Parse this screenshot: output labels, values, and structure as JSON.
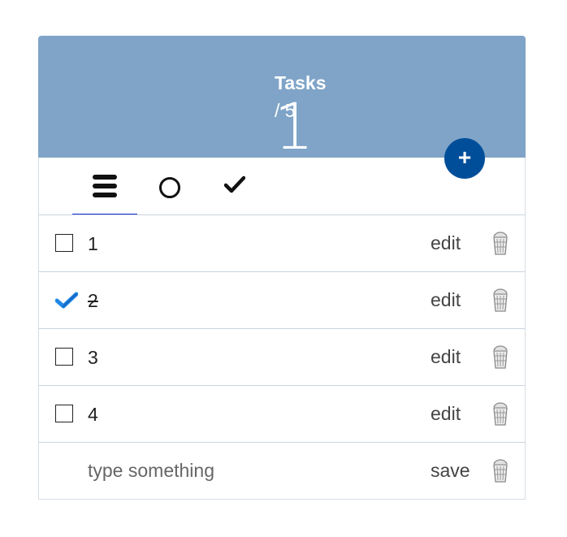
{
  "header": {
    "count": "1",
    "title": "Tasks",
    "total": "/ 5",
    "add_label": "+"
  },
  "tabs": [
    {
      "name": "all",
      "icon": "hamburger-icon",
      "active": true
    },
    {
      "name": "open",
      "icon": "circle-icon",
      "active": false
    },
    {
      "name": "done",
      "icon": "checkmark-icon",
      "active": false
    }
  ],
  "tasks": [
    {
      "text": "1",
      "done": false,
      "action": "edit"
    },
    {
      "text": "2",
      "done": true,
      "action": "edit"
    },
    {
      "text": "3",
      "done": false,
      "action": "edit"
    },
    {
      "text": "4",
      "done": false,
      "action": "edit"
    }
  ],
  "new_task": {
    "placeholder": "type something",
    "action": "save"
  },
  "colors": {
    "header_bg": "#7fa4c8",
    "add_button_bg": "#004e9a",
    "checked_tick": "#1e88e5",
    "active_tab_underline": "#1a2ed6"
  }
}
